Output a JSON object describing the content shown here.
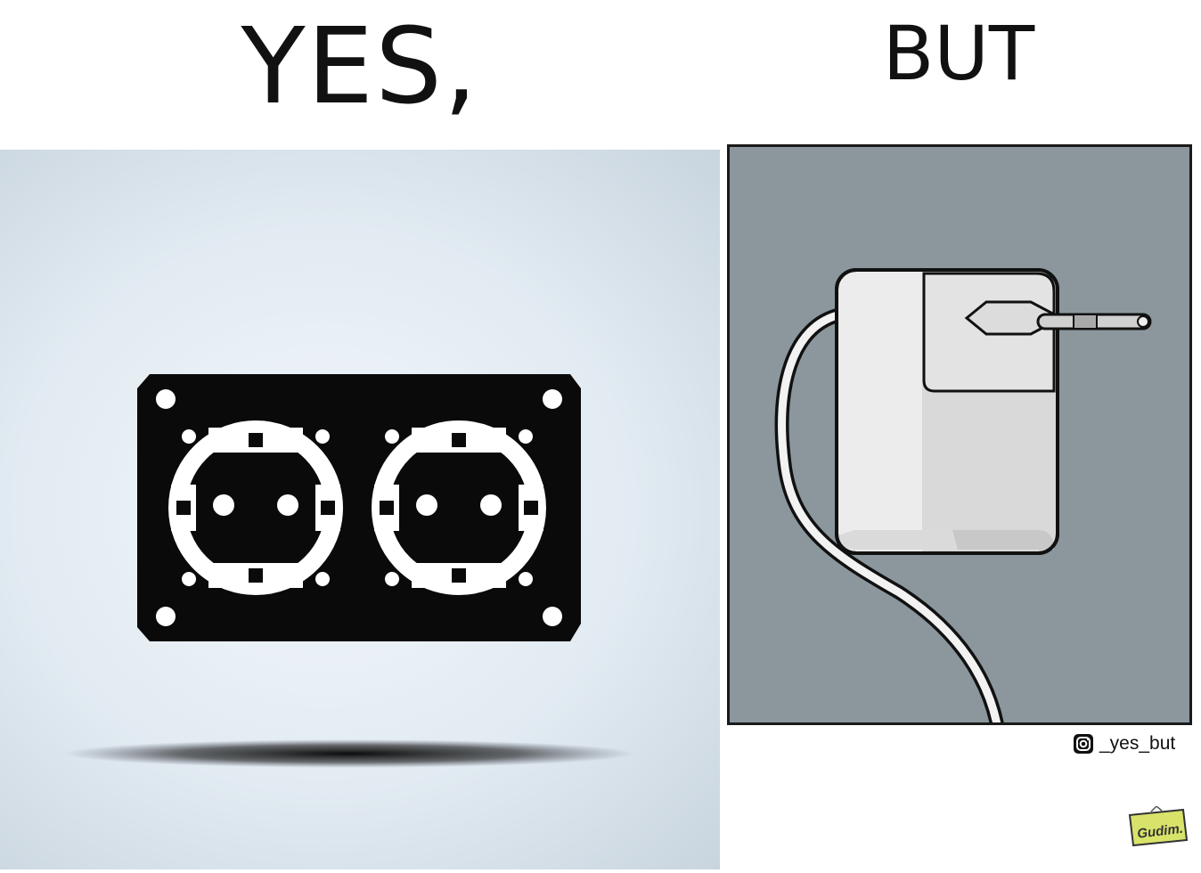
{
  "titles": {
    "left": "YES,",
    "right": "BUT"
  },
  "credit": {
    "icon": "instagram-icon",
    "handle": "_yes_but"
  },
  "badge": {
    "text": "Gudim."
  },
  "colors": {
    "socket_plate": "#0a0a0a",
    "left_background": "#e6eef4",
    "right_background": "#8b979d",
    "charger_body": "#ededed",
    "badge_fill": "#d8e36a"
  }
}
